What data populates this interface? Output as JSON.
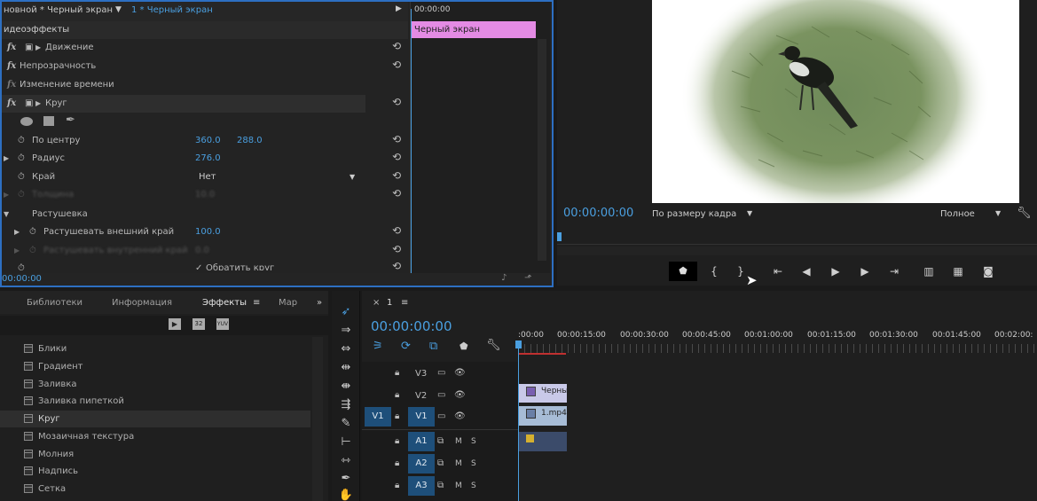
{
  "effect_controls": {
    "source_label": "новной * Черный экран",
    "seq_label": "1 * Черный экран",
    "section_title": "идеоэффекты",
    "timecode": "00:00:00",
    "clip_label": "Черный экран",
    "current_time": "00:00:00",
    "effects": {
      "motion": "Движение",
      "opacity": "Непрозрачность",
      "time_remap": "Изменение времени",
      "circle": "Круг"
    },
    "props": {
      "center": {
        "label": "По центру",
        "x": "360.0",
        "y": "288.0"
      },
      "radius": {
        "label": "Радиус",
        "value": "276.0"
      },
      "edge": {
        "label": "Край",
        "value": "Нет"
      },
      "thickness": {
        "label": "Толщина",
        "value": "10.0"
      },
      "feather_group": "Растушевка",
      "feather_outer": {
        "label": "Растушевать внешний край",
        "value": "100.0"
      },
      "feather_inner": {
        "label": "Растушевать внутренний край",
        "value": "0.0"
      },
      "invert": {
        "label": "Обратить круг"
      }
    }
  },
  "program_monitor": {
    "timecode": "00:00:00:00",
    "zoom": "По размеру кадра",
    "quality": "Полное"
  },
  "project_panel": {
    "tabs": [
      "Библиотеки",
      "Информация",
      "Эффекты",
      "Мар"
    ],
    "active_tab": "Эффекты",
    "effect_items": [
      "Блики",
      "Градиент",
      "Заливка",
      "Заливка пипеткой",
      "Круг",
      "Мозаичная текстура",
      "Молния",
      "Надпись",
      "Сетка"
    ],
    "selected_item": "Круг"
  },
  "timeline": {
    "sequence_name": "1",
    "timecode": "00:00:00:00",
    "ruler_labels": [
      ":00:00",
      "00:00:15:00",
      "00:00:30:00",
      "00:00:45:00",
      "00:01:00:00",
      "00:01:15:00",
      "00:01:30:00",
      "00:01:45:00",
      "00:02:00:"
    ],
    "tracks": {
      "v3": "V3",
      "v2": "V2",
      "v1": "V1",
      "v1src": "V1",
      "a1": "A1",
      "a2": "A2",
      "a3": "A3",
      "m": "M",
      "s": "S"
    },
    "clips": {
      "v2": "Черны",
      "v1": "1.mp4"
    }
  }
}
